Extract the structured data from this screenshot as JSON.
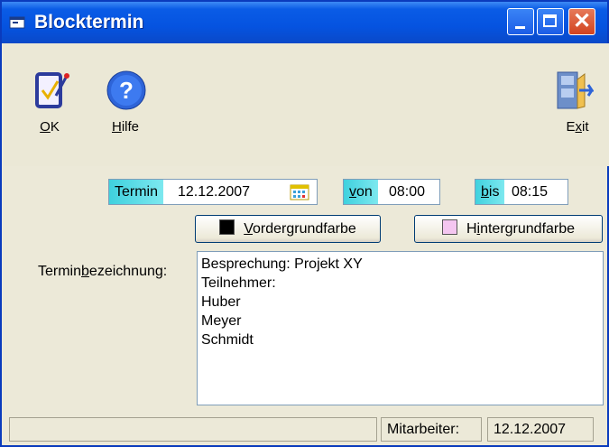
{
  "window": {
    "title": "Blocktermin"
  },
  "toolbar": {
    "ok_label_u": "O",
    "ok_label_rest": "K",
    "help_label_u": "H",
    "help_label_rest": "ilfe",
    "exit_label_pre": "E",
    "exit_label_u": "x",
    "exit_label_rest": "it"
  },
  "termin": {
    "caption": "Termin",
    "value": "12.12.2007"
  },
  "von": {
    "caption_u": "v",
    "caption_rest": "on",
    "value": "08:00"
  },
  "bis": {
    "caption_u": "b",
    "caption_rest": "is",
    "value": "08:15"
  },
  "buttons": {
    "foreground_u": "V",
    "foreground_rest": "ordergrundfarbe",
    "foreground_color": "#000000",
    "background_pre": "H",
    "background_u": "i",
    "background_rest": "ntergrundfarbe",
    "background_color": "#f4c6f0"
  },
  "description": {
    "label_pre": "Termin",
    "label_u": "b",
    "label_rest": "ezeichnung:",
    "text": "Besprechung: Projekt XY\nTeilnehmer:\nHuber\nMeyer\nSchmidt"
  },
  "status": {
    "panel1": "",
    "employee_label": "Mitarbeiter:",
    "date": "12.12.2007"
  },
  "icons": {
    "ok": "clipboard-check-icon",
    "help": "help-icon",
    "exit": "exit-door-icon",
    "calendar": "calendar-icon"
  }
}
